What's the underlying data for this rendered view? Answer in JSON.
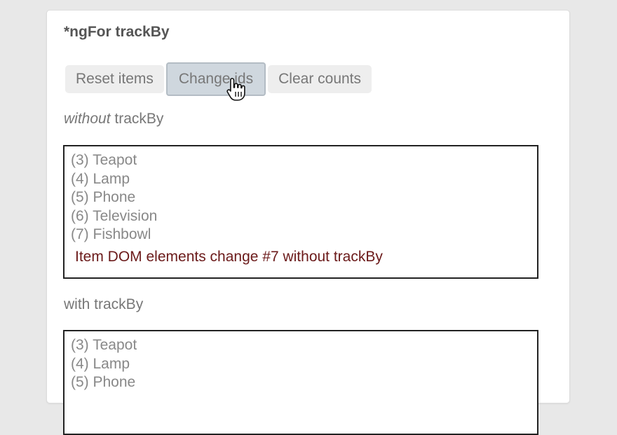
{
  "title": "*ngFor trackBy",
  "buttons": {
    "reset": "Reset items",
    "change": "Change ids",
    "clear": "Clear counts"
  },
  "without": {
    "label_em": "without",
    "label_rest": " trackBy",
    "items": [
      "(3) Teapot",
      "(4) Lamp",
      "(5) Phone",
      "(6) Television",
      "(7) Fishbowl"
    ],
    "message": "Item DOM elements change #7 without trackBy"
  },
  "with": {
    "label": "with trackBy",
    "items": [
      "(3) Teapot",
      "(4) Lamp",
      "(5) Phone"
    ]
  },
  "colors": {
    "message": "#6b1a1a",
    "pressed_button": "#cfd7de"
  }
}
